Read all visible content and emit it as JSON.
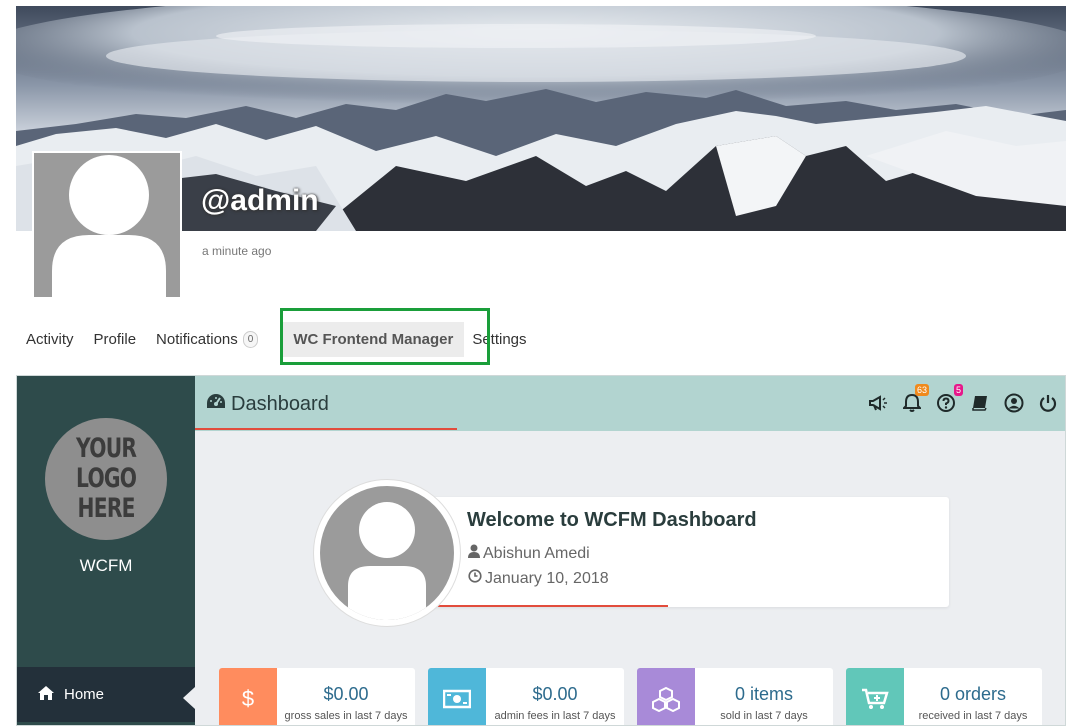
{
  "profile": {
    "handle": "@admin",
    "last_active": "a minute ago"
  },
  "nav": {
    "tabs": [
      {
        "label": "Activity"
      },
      {
        "label": "Profile"
      },
      {
        "label": "Notifications",
        "count": "0"
      },
      {
        "label": "WC Frontend Manager"
      },
      {
        "label": "Settings"
      }
    ]
  },
  "sidebar": {
    "logo_lines": [
      "YOUR",
      "LOGO",
      "HERE"
    ],
    "store_name": "WCFM",
    "menu": [
      {
        "label": "Home",
        "icon": "home-icon"
      }
    ]
  },
  "header": {
    "title": "Dashboard",
    "notification_count": "63",
    "enquiry_count": "5"
  },
  "welcome": {
    "title": "Welcome to WCFM Dashboard",
    "user": "Abishun Amedi",
    "date": "January 10, 2018"
  },
  "stats": [
    {
      "value": "$0.00",
      "label": "gross sales in last 7 days",
      "icon": "dollar-icon",
      "color": "#ff8c5e"
    },
    {
      "value": "$0.00",
      "label": "admin fees in last 7 days",
      "icon": "money-bill-icon",
      "color": "#4fb7d9"
    },
    {
      "value": "0 items",
      "label": "sold in last 7 days",
      "icon": "cubes-icon",
      "color": "#a88ad8"
    },
    {
      "value": "0 orders",
      "label": "received in last 7 days",
      "icon": "cart-icon",
      "color": "#61c7b9"
    }
  ],
  "colors": {
    "sidebar": "#2e4b4b",
    "header": "#b2d4d0",
    "accent_line": "#e24c3c",
    "highlight_box": "#1a9e3a",
    "stat_value": "#2d6b8d"
  }
}
